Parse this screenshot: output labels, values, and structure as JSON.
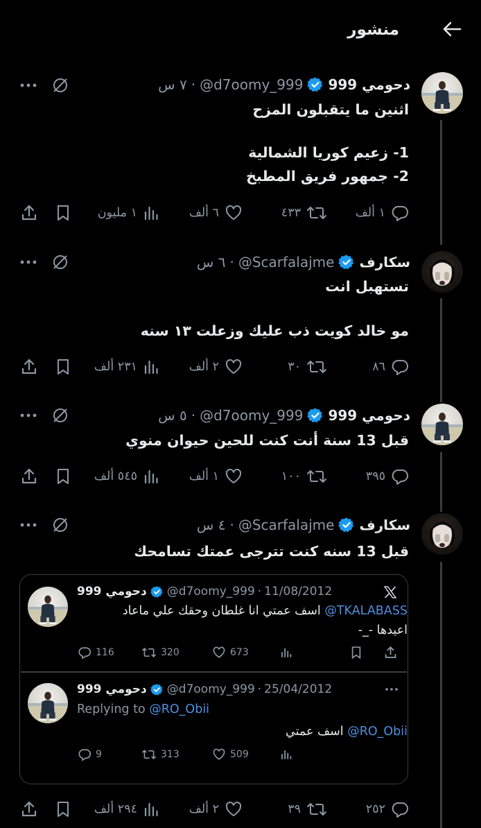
{
  "header": {
    "title": "منشور"
  },
  "tweets": [
    {
      "name": "دحومي 999",
      "handle": "@d7oomy_999",
      "time": "٧ س",
      "lines": [
        "اثنين ما يتقبلون المزح",
        "1- زعيم كوريا الشمالية",
        "2- جمهور فريق المطبخ"
      ],
      "actions": {
        "replies": "١ ألف",
        "retweets": "٤٣٣",
        "likes": "٦ ألف",
        "views": "١ مليون"
      }
    },
    {
      "name": "سكارف",
      "handle": "@Scarfalajme",
      "time": "٦ س",
      "lines": [
        "تستهبل انت",
        "مو خالد كويت ذب عليك وزعلت ١٣ سنه"
      ],
      "actions": {
        "replies": "٨٦",
        "retweets": "٣٠",
        "likes": "٢ ألف",
        "views": "٢٣١ ألف"
      }
    },
    {
      "name": "دحومي 999",
      "handle": "@d7oomy_999",
      "time": "٥ س",
      "lines": [
        "قبل 13 سنة أنت كنت للحين حيوان منوي"
      ],
      "actions": {
        "replies": "٣٩٥",
        "retweets": "١٠٠",
        "likes": "١ ألف",
        "views": "٥٤٥ ألف"
      }
    },
    {
      "name": "سكارف",
      "handle": "@Scarfalajme",
      "time": "٤ س",
      "lines": [
        "قبل 13 سنه كنت تترجى عمتك تسامحك"
      ],
      "actions": {
        "replies": "٢٥٢",
        "retweets": "٣٩",
        "likes": "٢ ألف",
        "views": "٢٩٤ ألف"
      }
    }
  ],
  "quote": {
    "items": [
      {
        "name": "دحومي 999",
        "handle": "@d7oomy_999",
        "date": "11/08/2012",
        "mention": "@TKALABASS",
        "text1": " اسف عمتي انا غلطان وحقك علي ماعاد",
        "text2": "اعيدها -_-",
        "replies": "116",
        "retweets": "320",
        "likes": "673"
      },
      {
        "name": "دحومي 999",
        "handle": "@d7oomy_999",
        "date": "25/04/2012",
        "replying_prefix": "Replying to",
        "replying_to": "@RO_Obii",
        "mention": "@RO_Obii",
        "text1": " اسف عمتي",
        "replies": "9",
        "retweets": "313",
        "likes": "509"
      }
    ]
  },
  "colors": {
    "background": "#000000",
    "text": "#e7e9ea",
    "muted": "#8b98a5",
    "verified": "#1d9bf0",
    "link": "#4f8fe0",
    "border": "#3a3d41"
  }
}
